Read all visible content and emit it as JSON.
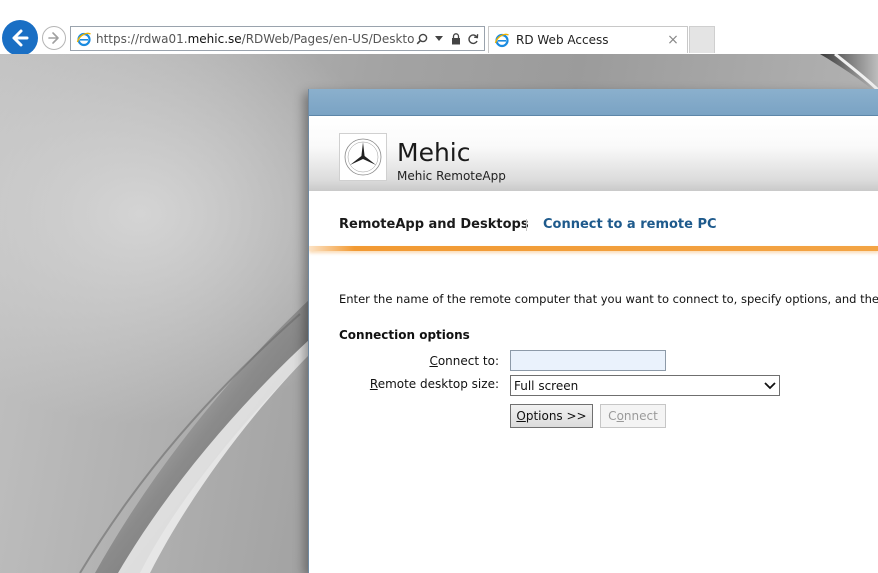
{
  "browser": {
    "url_prefix": "https://rdwa01.",
    "url_domain": "mehic.se",
    "url_path": "/RDWeb/Pages/en-US/Desktops.asp",
    "tab_title": "RD Web Access",
    "tab_close": "×"
  },
  "header": {
    "org_name": "Mehic",
    "org_subtitle": "Mehic RemoteApp"
  },
  "nav": {
    "items": [
      {
        "label": "RemoteApp and Desktops",
        "active": true
      },
      {
        "label": "Connect to a remote PC",
        "active": false
      }
    ]
  },
  "form": {
    "intro_text": "Enter the name of the remote computer that you want to connect to, specify options, and then click Co",
    "section_title": "Connection options",
    "connect_label_hotkey": "C",
    "connect_label_rest": "onnect to:",
    "connect_value": "",
    "size_label_hotkey": "R",
    "size_label_rest": "emote desktop size:",
    "size_value": "Full screen",
    "options_button_hotkey": "O",
    "options_button_rest": "ptions >>",
    "connect_button_pre": "C",
    "connect_button_hotkey": "o",
    "connect_button_rest": "nnect"
  },
  "colors": {
    "accent_orange": "#f29a33",
    "link_blue": "#1e5a8c",
    "topbar_blue": "#7aa3c4",
    "ie_blue": "#1a6fc4"
  }
}
